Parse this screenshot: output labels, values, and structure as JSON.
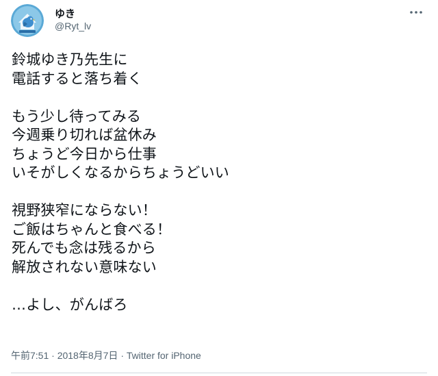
{
  "user": {
    "display_name": "ゆき",
    "handle": "@Ryt_lv",
    "avatar_icon": "bird-avatar-icon",
    "avatar_bg": "#1d9bf0"
  },
  "tweet": {
    "paragraphs": [
      [
        "鈴城ゆき乃先生に",
        "電話すると落ち着く"
      ],
      [
        "もう少し待ってみる",
        "今週乗り切れば盆休み",
        "ちょうど今日から仕事",
        "いそがしくなるからちょうどいい"
      ],
      [
        "視野狭窄にならない！",
        "ご飯はちゃんと食べる！",
        "死んでも念は残るから",
        "解放されない意味ない"
      ],
      [
        "…よし、がんばろ"
      ]
    ]
  },
  "meta": {
    "time": "午前7:51",
    "separator": "·",
    "date": "2018年8月7日",
    "source": "Twitter for iPhone"
  },
  "icons": {
    "more": "more-dots-icon"
  }
}
